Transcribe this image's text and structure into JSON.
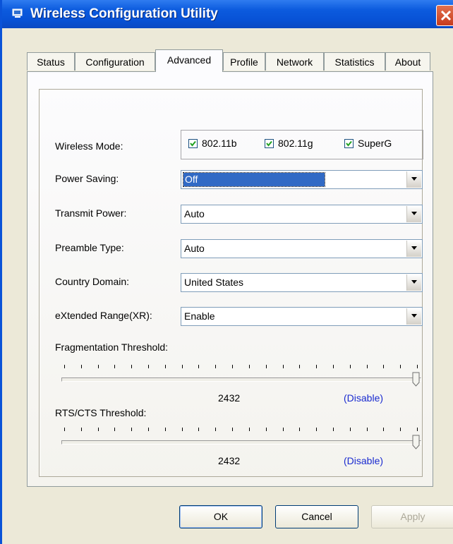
{
  "window": {
    "title": "Wireless Configuration Utility"
  },
  "tabs": [
    {
      "label": "Status"
    },
    {
      "label": "Configuration"
    },
    {
      "label": "Advanced"
    },
    {
      "label": "Profile"
    },
    {
      "label": "Network"
    },
    {
      "label": "Statistics"
    },
    {
      "label": "About"
    }
  ],
  "active_tab": "Advanced",
  "wireless_mode": {
    "label": "Wireless Mode:",
    "options": [
      {
        "label": "802.11b",
        "checked": true
      },
      {
        "label": "802.11g",
        "checked": true
      },
      {
        "label": "SuperG",
        "checked": true
      }
    ]
  },
  "fields": {
    "power_saving": {
      "label": "Power Saving:",
      "value": "Off"
    },
    "transmit_power": {
      "label": "Transmit Power:",
      "value": "Auto"
    },
    "preamble_type": {
      "label": "Preamble Type:",
      "value": "Auto"
    },
    "country_domain": {
      "label": "Country Domain:",
      "value": "United States"
    },
    "extended_range": {
      "label": "eXtended Range(XR):",
      "value": "Enable"
    }
  },
  "fragmentation": {
    "label": "Fragmentation Threshold:",
    "value": "2432",
    "status": "(Disable)",
    "level": 1.0
  },
  "rts_cts": {
    "label": "RTS/CTS Threshold:",
    "value": "2432",
    "status": "(Disable)",
    "level": 1.0
  },
  "buttons": {
    "ok": "OK",
    "cancel": "Cancel",
    "apply": "Apply"
  }
}
